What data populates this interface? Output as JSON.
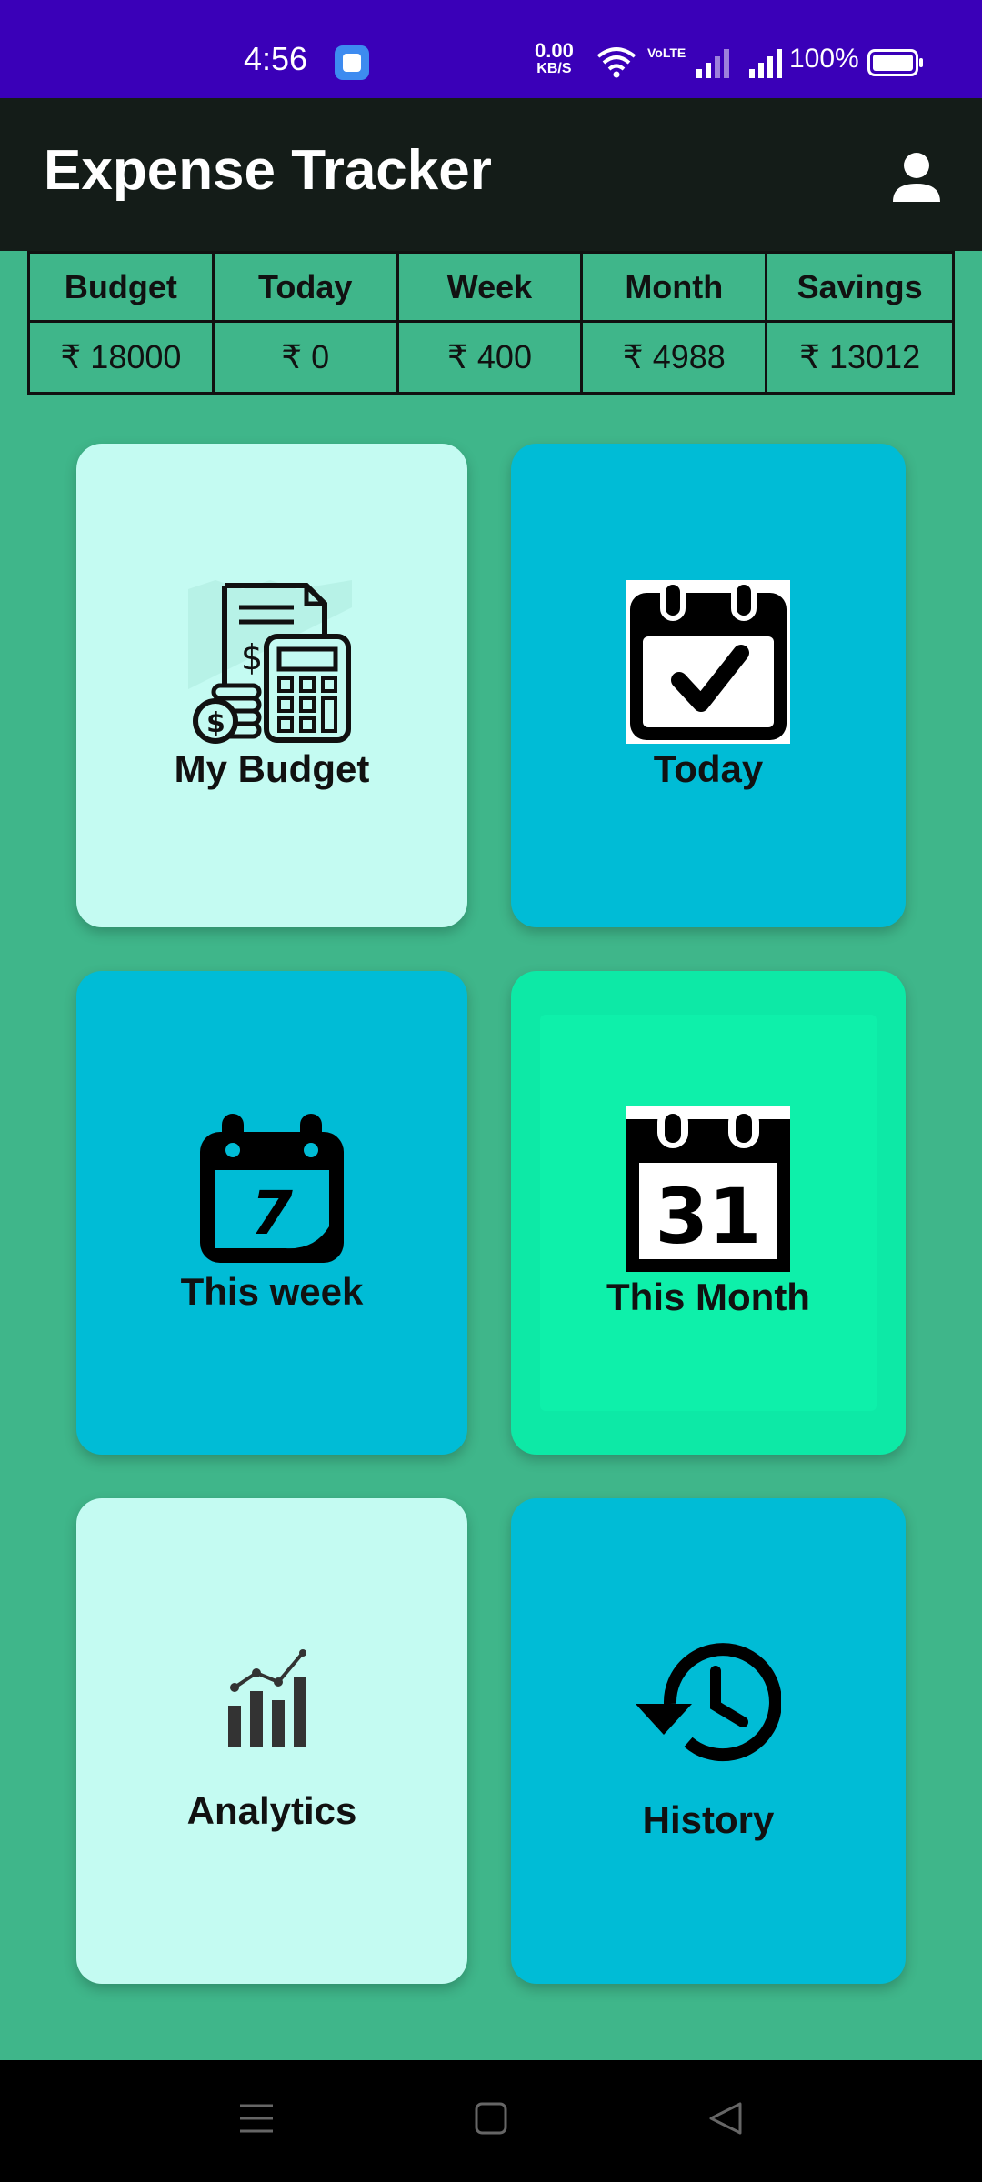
{
  "status_bar": {
    "time": "4:56",
    "net_speed": "0.00",
    "net_unit": "KB/S",
    "volte": "VoLTE",
    "battery": "100%"
  },
  "app_bar": {
    "title": "Expense Tracker",
    "profile_icon": "person-icon"
  },
  "summary": {
    "headers": [
      "Budget",
      "Today",
      "Week",
      "Month",
      "Savings"
    ],
    "values": [
      "₹ 18000",
      "₹ 0",
      "₹ 400",
      "₹ 4988",
      "₹ 13012"
    ]
  },
  "cards": [
    {
      "label": "My Budget",
      "icon": "budget-calculator-icon",
      "color": "#c4fbf2"
    },
    {
      "label": "Today",
      "icon": "calendar-check-icon",
      "color": "#00bcd6"
    },
    {
      "label": "This week",
      "icon": "calendar-7-icon",
      "color": "#00bcd6"
    },
    {
      "label": "This Month",
      "icon": "calendar-31-icon",
      "color": "#0de9a6"
    },
    {
      "label": "Analytics",
      "icon": "analytics-chart-icon",
      "color": "#c4fbf2"
    },
    {
      "label": "History",
      "icon": "history-clock-icon",
      "color": "#00bcd6"
    }
  ],
  "calendar_icon_numbers": {
    "week": "7",
    "month": "31"
  },
  "nav_bar": {
    "icons": [
      "menu-icon",
      "home-square-icon",
      "back-triangle-icon"
    ]
  },
  "colors": {
    "status_bar": "#3a00b8",
    "app_bar": "#141c18",
    "background": "#3fb68a",
    "card_light": "#c4fbf2",
    "card_blue": "#00bcd6",
    "card_green": "#0de9a6"
  }
}
